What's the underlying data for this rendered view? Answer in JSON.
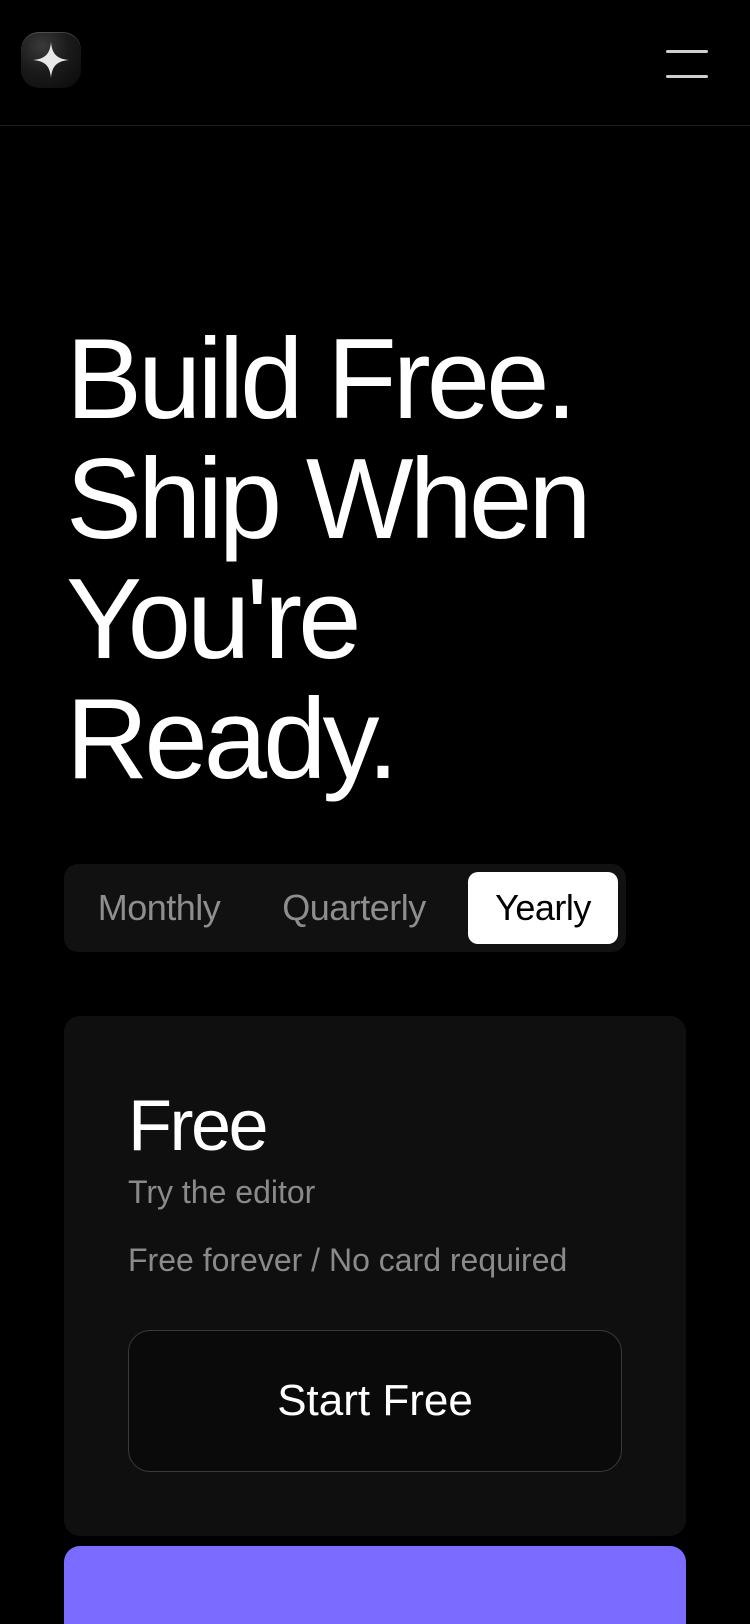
{
  "header": {
    "logo_icon": "sparkle-icon",
    "menu_icon": "hamburger-menu-icon"
  },
  "hero": {
    "lines": [
      "Build Free.",
      "Ship When",
      "You're",
      "Ready."
    ]
  },
  "billing": {
    "options": [
      "Monthly",
      "Quarterly",
      "Yearly"
    ],
    "selected": "Yearly"
  },
  "plans": [
    {
      "name": "Free",
      "description": "Try the editor",
      "note": "Free forever / No card required",
      "cta": "Start Free"
    }
  ],
  "colors": {
    "background": "#000000",
    "card": "#0f0f0f",
    "accent": "#7b6cff",
    "muted_text": "#8a8a8a",
    "selected_segment": "#ffffff"
  }
}
